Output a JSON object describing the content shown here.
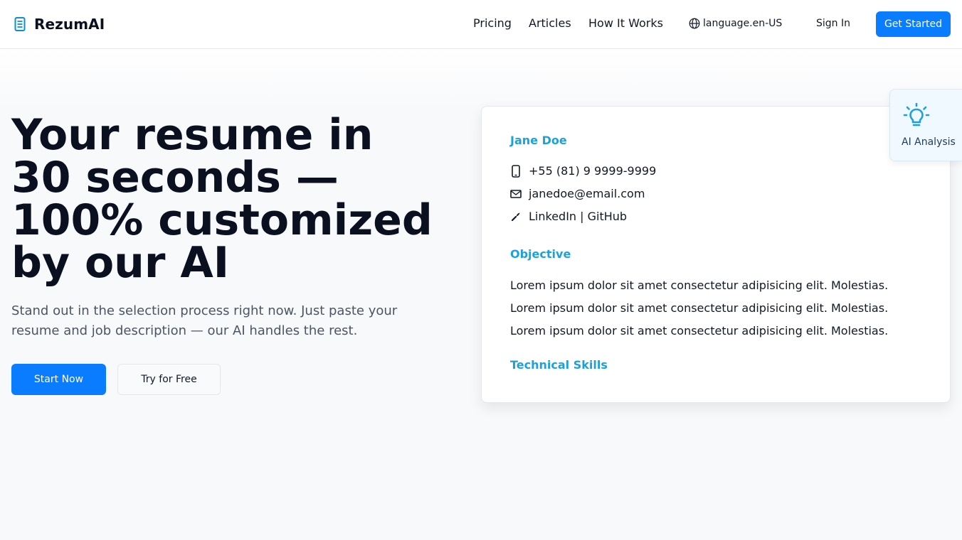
{
  "header": {
    "brand": "RezumAI",
    "nav": [
      "Pricing",
      "Articles",
      "How It Works"
    ],
    "language": "language.en-US",
    "sign_in": "Sign In",
    "get_started": "Get Started"
  },
  "hero": {
    "title_lines": [
      "Your resume in",
      "30 seconds —",
      "100% customized",
      "by our AI"
    ],
    "subtitle_lines": [
      "Stand out in the selection process right now. Just paste your",
      "resume and job description — our AI handles the rest."
    ],
    "start_now": "Start Now",
    "try_free": "Try for Free"
  },
  "resume": {
    "name": "Jane Doe",
    "contacts": [
      {
        "icon": "phone-icon",
        "glyph": "📱",
        "text": "+55 (81) 9 9999-9999"
      },
      {
        "icon": "email-icon",
        "glyph": "📧",
        "text": "janedoe@email.com"
      },
      {
        "icon": "link-icon",
        "glyph": "🔗",
        "text": "LinkedIn | GitHub"
      }
    ],
    "objective_heading": "Objective",
    "objective_lines": [
      "Lorem ipsum dolor sit amet consectetur adipisicing elit. Molestias.",
      "Lorem ipsum dolor sit amet consectetur adipisicing elit. Molestias.",
      "Lorem ipsum dolor sit amet consectetur adipisicing elit. Molestias."
    ],
    "skills_heading": "Technical Skills"
  },
  "ai_badge": {
    "label": "AI Analysis",
    "icon": "lightbulb-icon"
  },
  "colors": {
    "accent": "#0a7cff",
    "heading_blue": "#1ca1dc"
  }
}
